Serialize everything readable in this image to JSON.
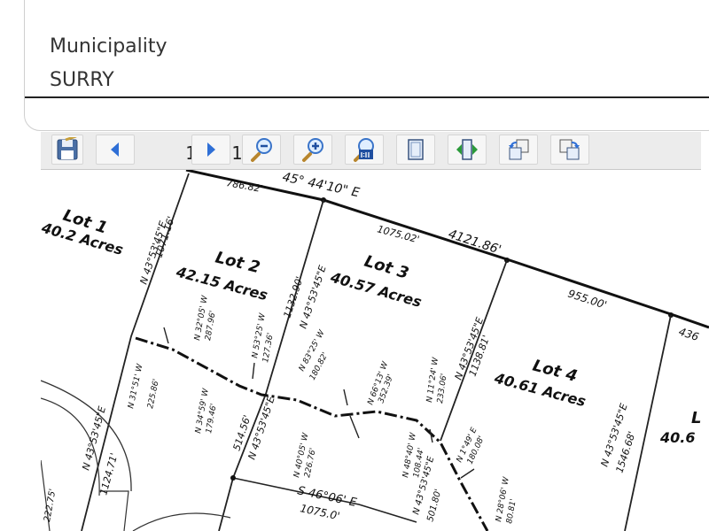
{
  "field": {
    "label": "Municipality",
    "value": "SURRY"
  },
  "viewer": {
    "page_indicator": "1 / 1",
    "buttons": [
      "save",
      "previous-page",
      "next-page",
      "zoom-out",
      "zoom-in",
      "actual-size",
      "fit-page",
      "fit-width",
      "rotate-left",
      "rotate-right"
    ]
  },
  "plat": {
    "lots": [
      {
        "name": "Lot 1",
        "acres": "40.2 Acres"
      },
      {
        "name": "Lot 2",
        "acres": "42.15 Acres"
      },
      {
        "name": "Lot 3",
        "acres": "40.57 Acres"
      },
      {
        "name": "Lot 4",
        "acres": "40.61 Acres"
      },
      {
        "name": "L",
        "acres": "40.6"
      }
    ],
    "bearings": {
      "top_bearing": "S 45° 44' 10\" E",
      "top_bearing_visible": "45° 44'10\" E",
      "bottom_bearing": "S 46°06' E",
      "n43_a": "N 43°53'45\"E",
      "n43_b": "N 43°53'45\"E",
      "n43_c": "N 43°53'45\"E",
      "n43_d": "N 43°53'45\"E",
      "n43_e": "N 43°53'45\"E",
      "n43_f": "N 43°53'45\"E",
      "n43_g": "N 43°53'45\"E"
    },
    "distances": {
      "d786": "786.82'",
      "d1075_02": "1075.02'",
      "d4121": "4121.86'",
      "d955": "955.00'",
      "d436": "436",
      "d1071": "1071.16'",
      "d1132": "1132.90'",
      "d1138": "1138.81'",
      "d1546": "1546.68'",
      "d514": "514.56'",
      "d1124": "1124.71'",
      "d1075_0": "1075.0'",
      "d501": "501.80'",
      "d222": "222.75'"
    },
    "creek_labels": {
      "c1": "N 32°05' W",
      "c1b": "287.96'",
      "c2": "N 53°25' W",
      "c2b": "127.36'",
      "c3": "N 83°25' W",
      "c3b": "180.82'",
      "c4": "N 66°13' W",
      "c4b": "352.39'",
      "c5": "N 11°24' W",
      "c5b": "233.06'",
      "c6": "N 31°51' W",
      "c6b": "225.86'",
      "c7": "N 34°59' W",
      "c7b": "179.46'",
      "c8": "N 40°05' W",
      "c8b": "226.76'",
      "c9": "N 48°40' W",
      "c9b": "108.44'",
      "c10": "N 1°49' E",
      "c10b": "180.08'",
      "c11": "N 28°06' W",
      "c11b": "80.81'"
    }
  }
}
